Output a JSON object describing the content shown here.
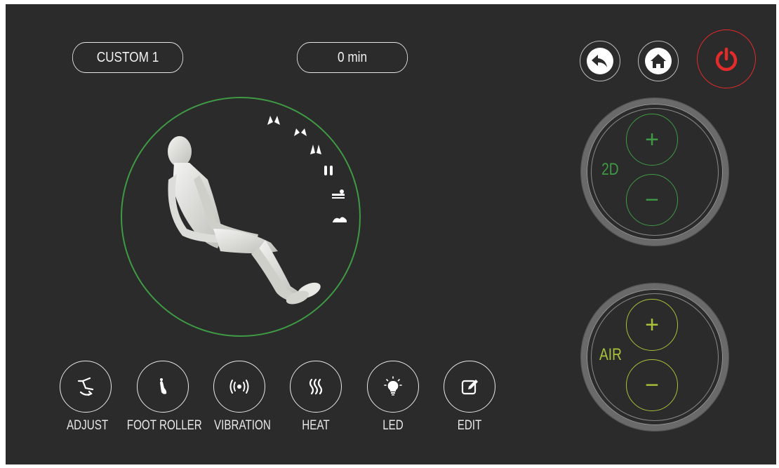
{
  "header": {
    "program_label": "CUSTOM 1",
    "time_label": "0 min"
  },
  "top_controls": {
    "back_icon": "back-arrow-icon",
    "home_icon": "home-icon",
    "power_icon": "power-icon",
    "power_color": "#e22b2b"
  },
  "controls_2d": {
    "label": "2D",
    "plus": "+",
    "minus": "−",
    "color": "#3f9a45"
  },
  "controls_air": {
    "label": "AIR",
    "plus": "+",
    "minus": "−",
    "color": "#a8c23a"
  },
  "massage_modes": [
    {
      "icon": "knead-hands-icon"
    },
    {
      "icon": "tap-hands-icon"
    },
    {
      "icon": "clap-hands-icon"
    },
    {
      "icon": "press-hands-icon"
    },
    {
      "icon": "shiatsu-icon"
    },
    {
      "icon": "rolling-icon"
    }
  ],
  "functions": [
    {
      "label": "ADJUST",
      "icon": "recline-adjust-icon"
    },
    {
      "label": "FOOT ROLLER",
      "icon": "foot-icon"
    },
    {
      "label": "VIBRATION",
      "icon": "vibration-icon"
    },
    {
      "label": "HEAT",
      "icon": "heat-icon"
    },
    {
      "label": "LED",
      "icon": "light-bulb-icon"
    },
    {
      "label": "EDIT",
      "icon": "edit-icon"
    }
  ]
}
